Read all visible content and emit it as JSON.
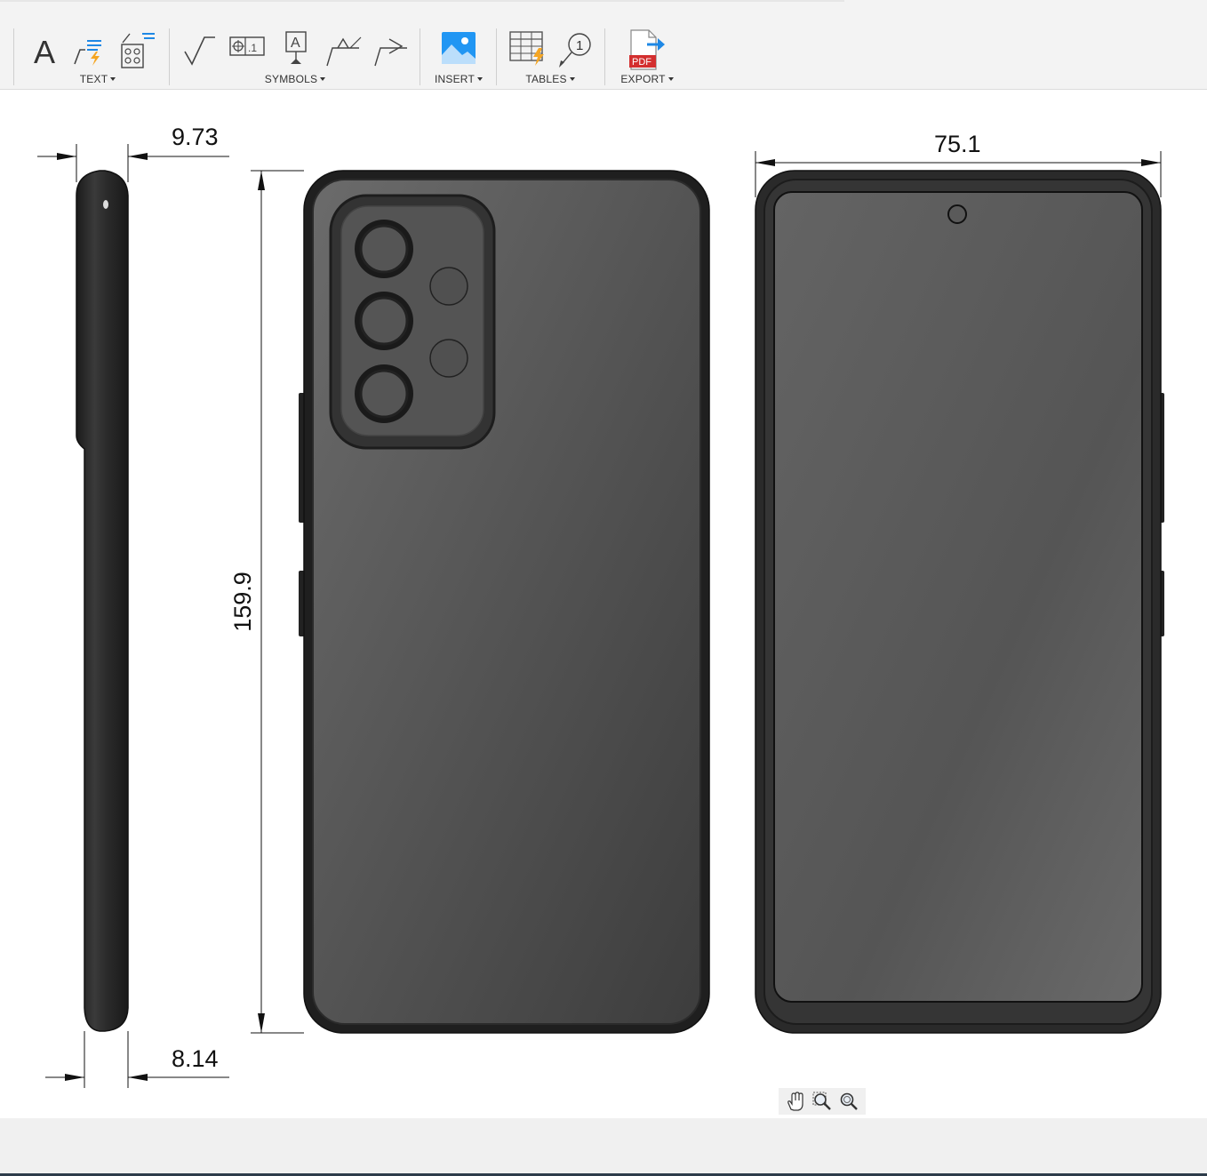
{
  "toolbar": {
    "groups": {
      "text": "TEXT",
      "symbols": "SYMBOLS",
      "insert": "INSERT",
      "tables": "TABLES",
      "export": "EXPORT"
    },
    "text_tool_glyph": "A",
    "pdf_label": "PDF",
    "balloon_number": "1"
  },
  "drawing": {
    "dimensions": {
      "side_top_thickness": "9.73",
      "side_bottom_thickness": "8.14",
      "height": "159.9",
      "width": "75.1"
    }
  },
  "navigation": {
    "icons": [
      "pan-hand-icon",
      "zoom-window-icon",
      "zoom-icon"
    ]
  },
  "colors": {
    "body_dark": "#2a2a2a",
    "screen_gray": "#5e5e5e",
    "accent_blue": "#1e88e5",
    "pdf_red": "#d32f2f"
  }
}
